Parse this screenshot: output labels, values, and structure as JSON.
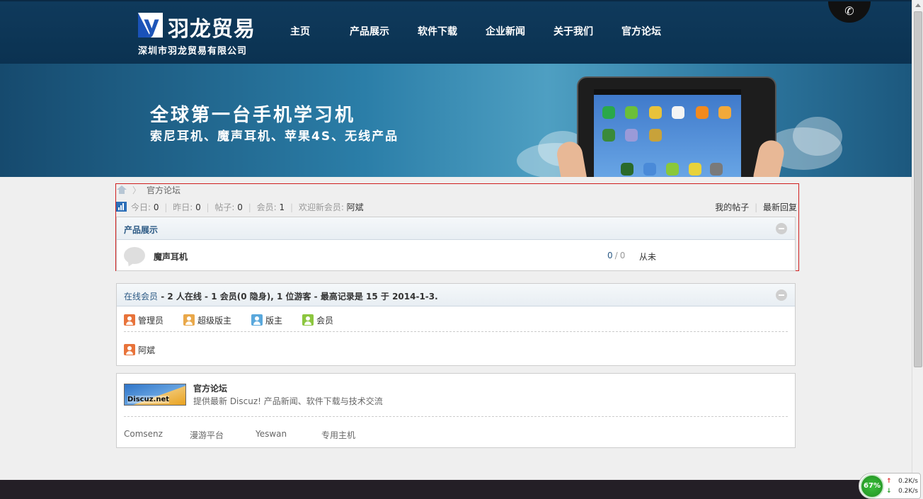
{
  "header": {
    "logo_mark": "y",
    "logo_name": "羽龙贸易",
    "logo_subtitle": "深圳市羽龙贸易有限公司",
    "nav": [
      "主页",
      "产品展示",
      "软件下载",
      "企业新闻",
      "关于我们",
      "官方论坛"
    ],
    "phone_icon": "phone-icon"
  },
  "banner": {
    "headline": "全球第一台手机学习机",
    "subline": "索尼耳机、魔声耳机、苹果4S、无线产品"
  },
  "breadcrumb": {
    "current": "官方论坛"
  },
  "stats": {
    "today_label": "今日: ",
    "today_value": "0",
    "yesterday_label": "昨日: ",
    "yesterday_value": "0",
    "posts_label": "帖子: ",
    "posts_value": "0",
    "members_label": "会员: ",
    "members_value": "1",
    "welcome_label": "欢迎新会员: ",
    "welcome_user": "阿斌",
    "my_posts": "我的帖子",
    "latest_replies": "最新回复"
  },
  "category": {
    "title": "产品展示",
    "forums": [
      {
        "name": "魔声耳机",
        "threads": "0",
        "posts": "0",
        "last_post": "从未"
      }
    ]
  },
  "online": {
    "label": "在线会员",
    "summary": " - 2 人在线 - 1 会员(0 隐身), 1 位游客 - 最高记录是 15 于 2014-1-3.",
    "legend": [
      {
        "label": "管理员",
        "color": "#e8733a"
      },
      {
        "label": "超级版主",
        "color": "#e9a84a"
      },
      {
        "label": "版主",
        "color": "#5aa8dc"
      },
      {
        "label": "会员",
        "color": "#8cc63f"
      }
    ],
    "users": [
      {
        "name": "阿斌",
        "color": "#e8733a"
      }
    ]
  },
  "links": {
    "logo_text": "Discuz.net",
    "title": "官方论坛",
    "description": "提供最新 Discuz! 产品新闻、软件下载与技术交流",
    "items": [
      "Comsenz",
      "漫游平台",
      "Yeswan",
      "专用主机"
    ]
  },
  "speed_widget": {
    "percent": "67%",
    "upload": "0.2K/s",
    "download": "0.2K/s"
  }
}
